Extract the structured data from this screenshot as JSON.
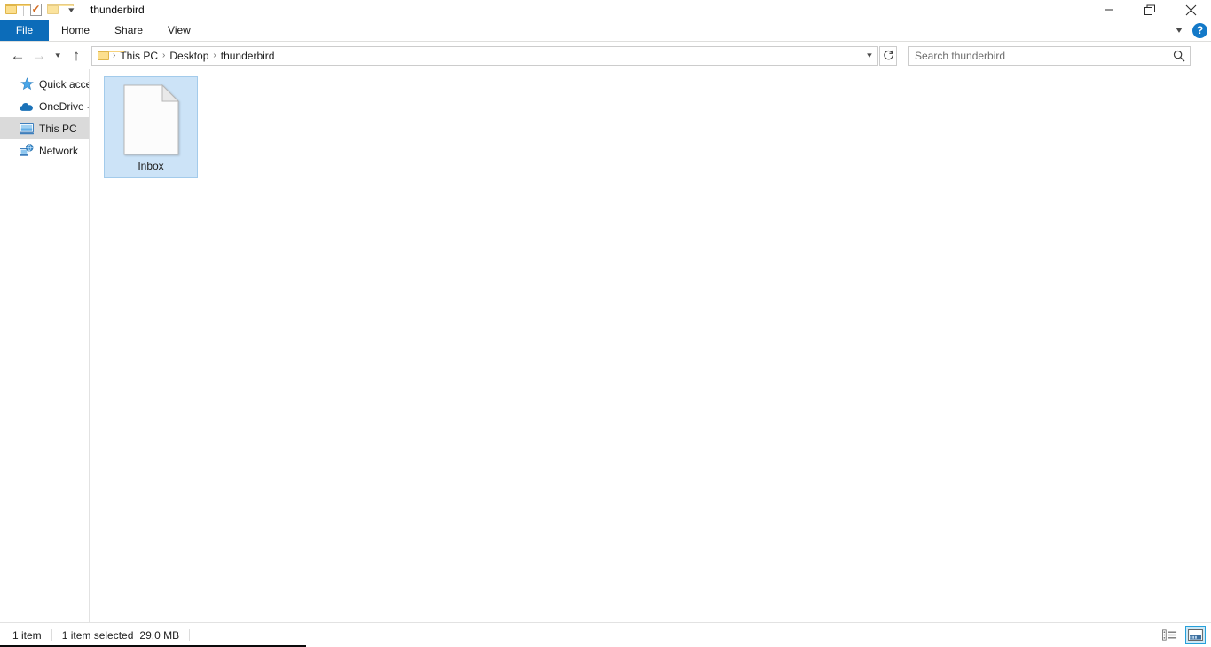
{
  "window": {
    "title": "thunderbird",
    "quick_access": [
      {
        "name": "folder-properties",
        "icon": "folder-icon"
      },
      {
        "name": "properties",
        "icon": "properties-check-icon"
      },
      {
        "name": "new-folder",
        "icon": "folder-icon"
      },
      {
        "name": "customize",
        "icon": "chevron-down-icon"
      }
    ],
    "caption": {
      "minimize": "—",
      "maximize": "restore-icon",
      "close": "✕"
    }
  },
  "ribbon": {
    "tabs": [
      {
        "label": "File",
        "active": true
      },
      {
        "label": "Home",
        "active": false
      },
      {
        "label": "Share",
        "active": false
      },
      {
        "label": "View",
        "active": false
      }
    ],
    "collapse_icon": "chevron-down-icon",
    "help_label": "?"
  },
  "nav": {
    "back_icon": "arrow-left-icon",
    "forward_icon": "arrow-right-icon",
    "recent_icon": "chevron-down-icon",
    "up_icon": "arrow-up-icon",
    "breadcrumb": [
      "This PC",
      "Desktop",
      "thunderbird"
    ],
    "breadcrumb_separator": "›",
    "address_dropdown_icon": "chevron-down-icon",
    "refresh_icon": "refresh-icon"
  },
  "search": {
    "placeholder": "Search thunderbird",
    "icon": "search-icon"
  },
  "sidebar": {
    "items": [
      {
        "label": "Quick acce",
        "icon": "star-icon",
        "selected": false
      },
      {
        "label": "OneDrive -",
        "icon": "cloud-icon",
        "selected": false
      },
      {
        "label": "This PC",
        "icon": "monitor-icon",
        "selected": true
      },
      {
        "label": "Network",
        "icon": "network-icon",
        "selected": false
      }
    ]
  },
  "content": {
    "items": [
      {
        "label": "Inbox",
        "icon": "blank-document-icon",
        "selected": true
      }
    ]
  },
  "status": {
    "item_count": "1 item",
    "selection": "1 item selected",
    "size": "29.0 MB",
    "views": [
      {
        "name": "details-view",
        "active": false
      },
      {
        "name": "large-icons-view",
        "active": true
      }
    ]
  },
  "colors": {
    "file_tab": "#0c6cb9",
    "selection_fill": "#cce3f7",
    "selection_border": "#a3cbeb",
    "sidebar_selected": "#dadada",
    "help_blue": "#1379c8"
  }
}
